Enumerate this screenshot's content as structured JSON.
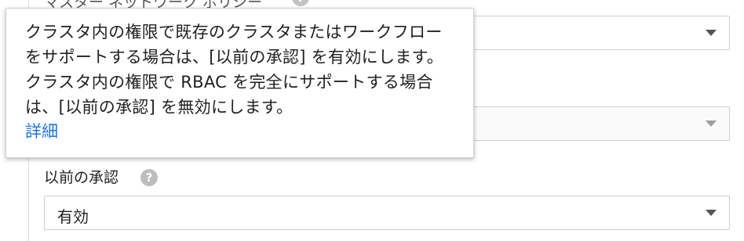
{
  "top_field": {
    "label": "マスター ネットワーク ポリシー",
    "help_icon": "?"
  },
  "tooltip": {
    "text": "クラスタ内の権限で既存のクラスタまたはワークフローをサポートする場合は、[以前の承認] を有効にします。クラスタ内の権限で RBAC を完全にサポートする場合は、[以前の承認] を無効にします。",
    "link": "詳細"
  },
  "legacy_auth": {
    "label": "以前の承認",
    "help_icon": "?",
    "value": "有効"
  },
  "icons": {
    "dropdown": "triangle-down",
    "help": "question-mark-circle"
  },
  "colors": {
    "link": "#1a73e8",
    "help_icon_bg": "#bdbdbd"
  }
}
